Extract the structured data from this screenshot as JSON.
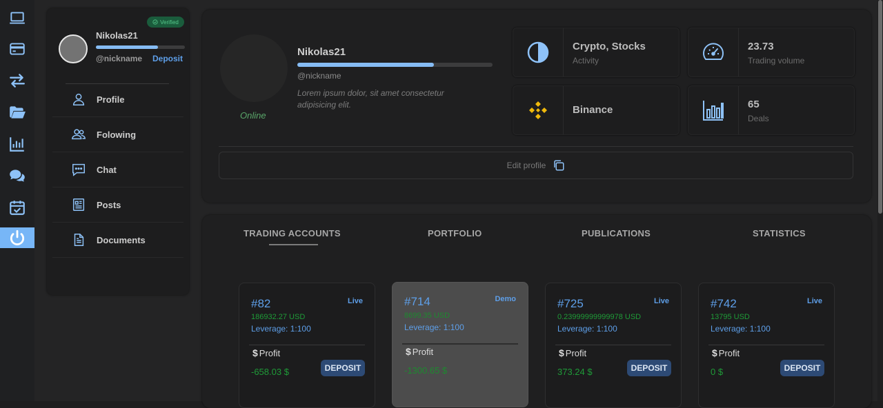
{
  "rail": {
    "items": [
      {
        "icon": "laptop-icon"
      },
      {
        "icon": "credit-card-icon"
      },
      {
        "icon": "transfer-arrows-icon"
      },
      {
        "icon": "folder-open-icon"
      },
      {
        "icon": "bar-chart-icon"
      },
      {
        "icon": "chat-bubbles-icon"
      },
      {
        "icon": "calendar-check-icon"
      },
      {
        "icon": "power-icon",
        "active": true
      }
    ],
    "active_color": "#77b6f7",
    "icon_color": "#8ec2f8"
  },
  "sidebar": {
    "name": "Nikolas21",
    "nickname": "@nickname",
    "deposit_link": "Deposit",
    "verified_badge": "Verified",
    "progress": 0.7,
    "menu": [
      {
        "label": "Profile",
        "icon": "user-icon"
      },
      {
        "label": "Folowing",
        "icon": "users-icon"
      },
      {
        "label": "Chat",
        "icon": "chat-icon"
      },
      {
        "label": "Posts",
        "icon": "newspaper-icon"
      },
      {
        "label": "Documents",
        "icon": "document-icon"
      }
    ]
  },
  "profile": {
    "name": "Nikolas21",
    "nickname": "@nickname",
    "description": "Lorem ipsum dolor, sit amet consectetur adipisicing elit.",
    "status": "Online",
    "progress": 0.7,
    "edit_label": "Edit profile"
  },
  "stats": [
    {
      "value": "Crypto, Stocks",
      "label": "Activity",
      "icon": "half-circle-icon"
    },
    {
      "value": "23.73",
      "label": "Trading volume",
      "icon": "speedometer-icon"
    },
    {
      "value": "Binance",
      "label": "",
      "icon": "binance-logo-icon"
    },
    {
      "value": "65",
      "label": "Deals",
      "icon": "bar-chart-icon"
    }
  ],
  "tabs": [
    {
      "label": "TRADING ACCOUNTS",
      "active": true
    },
    {
      "label": "PORTFOLIO"
    },
    {
      "label": "PUBLICATIONS"
    },
    {
      "label": "STATISTICS"
    }
  ],
  "accounts": [
    {
      "number": "#82",
      "type": "Live",
      "balance": "186932.27 USD",
      "leverage": "Leverage: 1:100",
      "profit_label": "Profit",
      "profit": "-658.03 $",
      "deposit": "DEPOSIT"
    },
    {
      "number": "#714",
      "type": "Demo",
      "balance": "8699.35 USD",
      "leverage": "Leverage: 1:100",
      "profit_label": "Profit",
      "profit": "-1300.65 $",
      "deposit": ""
    },
    {
      "number": "#725",
      "type": "Live",
      "balance": "0.23999999999978 USD",
      "leverage": "Leverage: 1:100",
      "profit_label": "Profit",
      "profit": "373.24 $",
      "deposit": "DEPOSIT"
    },
    {
      "number": "#742",
      "type": "Live",
      "balance": "13795 USD",
      "leverage": "Leverage: 1:100",
      "profit_label": "Profit",
      "profit": "0 $",
      "deposit": "DEPOSIT"
    }
  ],
  "colors": {
    "accent": "#5e9fe9",
    "positive": "#1f9b38",
    "verified": "#56c98b",
    "binance": "#f0b90b"
  }
}
